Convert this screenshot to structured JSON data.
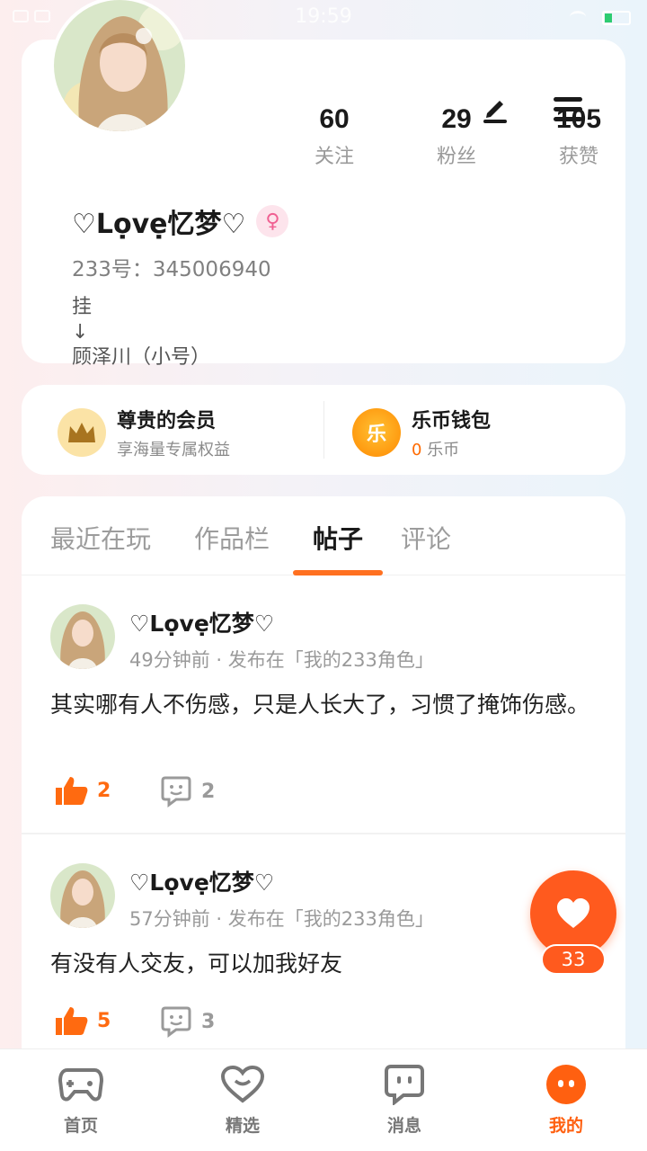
{
  "status_bar": {
    "time": "19:59"
  },
  "profile": {
    "stats": [
      {
        "num": "60",
        "label": "关注"
      },
      {
        "num": "29",
        "label": "粉丝"
      },
      {
        "num": "105",
        "label": "获赞"
      }
    ],
    "name": "♡Lọvẹ忆梦♡",
    "gender_symbol": "♀",
    "uid": "233号：345006940",
    "bio": "挂\n↓\n顾泽川（小号）"
  },
  "vip": {
    "member_title": "尊贵的会员",
    "member_sub": "享海量专属权益",
    "wallet_title": "乐币钱包",
    "wallet_icon_char": "乐",
    "wallet_amount": "0",
    "wallet_unit": "乐币"
  },
  "tabs": [
    {
      "label": "最近在玩"
    },
    {
      "label": "作品栏"
    },
    {
      "label": "帖子",
      "active": true
    },
    {
      "label": "评论"
    }
  ],
  "posts": [
    {
      "author": "♡Lọvẹ忆梦♡",
      "meta": "49分钟前 · 发布在「我的233角色」",
      "text": "其实哪有人不伤感，只是人长大了，习惯了掩饰伤感。",
      "likes": "2",
      "comments": "2"
    },
    {
      "author": "♡Lọvẹ忆梦♡",
      "meta": "57分钟前 · 发布在「我的233角色」",
      "text": "有没有人交友，可以加我好友",
      "likes": "5",
      "comments": "3"
    }
  ],
  "floating_like": {
    "count": "33"
  },
  "bottom_nav": [
    {
      "label": "首页",
      "icon": "gamepad-icon"
    },
    {
      "label": "精选",
      "icon": "heart-icon"
    },
    {
      "label": "消息",
      "icon": "chat-icon"
    },
    {
      "label": "我的",
      "icon": "profile-face-icon",
      "active": true
    }
  ],
  "colors": {
    "accent": "#ff6a10",
    "gender_pink": "#f06092"
  }
}
